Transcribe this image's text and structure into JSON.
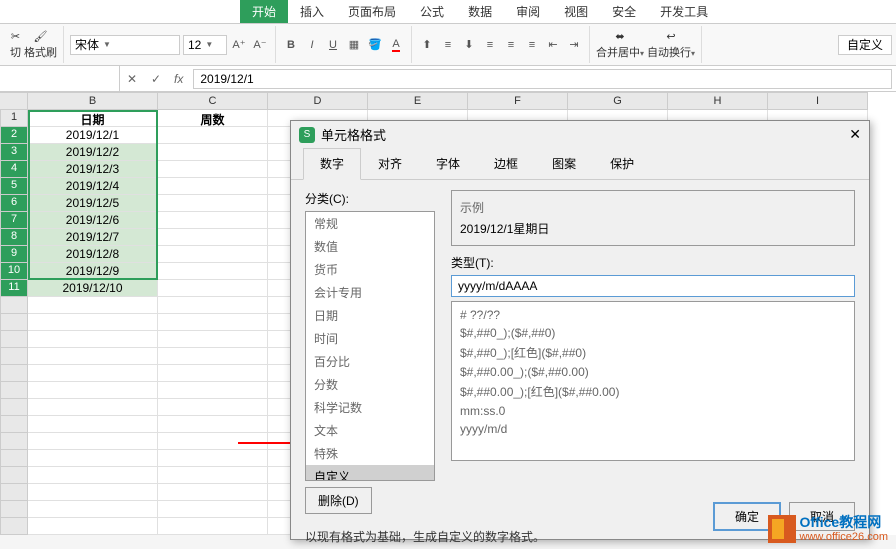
{
  "ribbon": {
    "tabs": [
      "开始",
      "插入",
      "页面布局",
      "公式",
      "数据",
      "审阅",
      "视图",
      "安全",
      "开发工具"
    ],
    "active_tab": "开始",
    "left_buttons": {
      "cut": "切",
      "format_painter": "格式刷"
    },
    "font_name": "宋体",
    "font_size": "12",
    "merge_center": "合并居中",
    "wrap_text": "自动换行",
    "format_dropdown": "自定义"
  },
  "formula_bar": {
    "name_box": "",
    "value": "2019/12/1"
  },
  "columns": [
    "B",
    "C",
    "D",
    "E",
    "F",
    "G",
    "H",
    "I"
  ],
  "headers": {
    "B": "日期",
    "C": "周数"
  },
  "dates": [
    "2019/12/1",
    "2019/12/2",
    "2019/12/3",
    "2019/12/4",
    "2019/12/5",
    "2019/12/6",
    "2019/12/7",
    "2019/12/8",
    "2019/12/9",
    "2019/12/10"
  ],
  "dialog": {
    "title": "单元格格式",
    "tabs": [
      "数字",
      "对齐",
      "字体",
      "边框",
      "图案",
      "保护"
    ],
    "active_tab": "数字",
    "category_label": "分类(C):",
    "categories": [
      "常规",
      "数值",
      "货币",
      "会计专用",
      "日期",
      "时间",
      "百分比",
      "分数",
      "科学记数",
      "文本",
      "特殊",
      "自定义"
    ],
    "selected_category": "自定义",
    "delete_btn": "删除(D)",
    "example_label": "示例",
    "example_value": "2019/12/1星期日",
    "type_label": "类型(T):",
    "type_value": "yyyy/m/dAAAA",
    "formats": [
      "# ??/??",
      "$#,##0_);($#,##0)",
      "$#,##0_);[红色]($#,##0)",
      "$#,##0.00_);($#,##0.00)",
      "$#,##0.00_);[红色]($#,##0.00)",
      "mm:ss.0",
      "yyyy/m/d"
    ],
    "hint": "以现有格式为基础，生成自定义的数字格式。",
    "ok": "确定",
    "cancel": "取消"
  },
  "watermark": {
    "line1": "Office教程网",
    "line2": "www.office26.com"
  }
}
